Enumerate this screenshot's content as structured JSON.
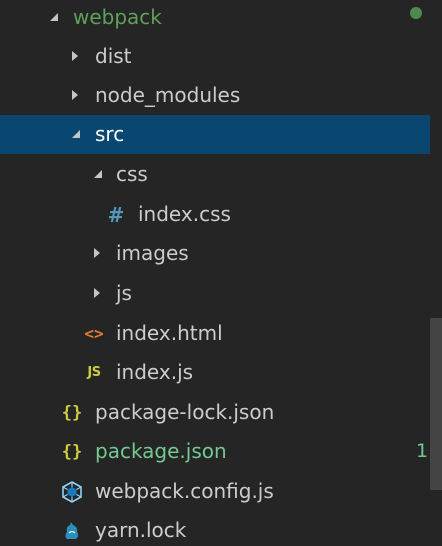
{
  "explorer": {
    "items": [
      {
        "label": "webpack",
        "type": "folder",
        "expanded": true,
        "git_status": "modified-dot"
      },
      {
        "label": "dist",
        "type": "folder",
        "expanded": false
      },
      {
        "label": "node_modules",
        "type": "folder",
        "expanded": false
      },
      {
        "label": "src",
        "type": "folder",
        "expanded": true,
        "selected": true
      },
      {
        "label": "css",
        "type": "folder",
        "expanded": true
      },
      {
        "label": "index.css",
        "type": "file",
        "icon": "css-hash-icon",
        "icon_glyph": "#"
      },
      {
        "label": "images",
        "type": "folder",
        "expanded": false
      },
      {
        "label": "js",
        "type": "folder",
        "expanded": false
      },
      {
        "label": "index.html",
        "type": "file",
        "icon": "html-icon",
        "icon_glyph": "<>"
      },
      {
        "label": "index.js",
        "type": "file",
        "icon": "js-icon",
        "icon_glyph": "JS"
      },
      {
        "label": "package-lock.json",
        "type": "file",
        "icon": "json-icon",
        "icon_glyph": "{}"
      },
      {
        "label": "package.json",
        "type": "file",
        "icon": "json-icon",
        "icon_glyph": "{}",
        "git_status": "untracked",
        "badge": "1"
      },
      {
        "label": "webpack.config.js",
        "type": "file",
        "icon": "webpack-icon"
      },
      {
        "label": "yarn.lock",
        "type": "file",
        "icon": "yarn-icon"
      }
    ]
  },
  "colors": {
    "background": "#252526",
    "selection": "#094771",
    "text": "#cccccc",
    "git_untracked": "#73c991",
    "css_icon": "#519aba",
    "html_icon": "#e37933",
    "js_icon": "#cbcb41",
    "json_icon": "#cbcb41",
    "webpack_icon": "#8ed6fb",
    "yarn_icon": "#2c8ebb"
  }
}
